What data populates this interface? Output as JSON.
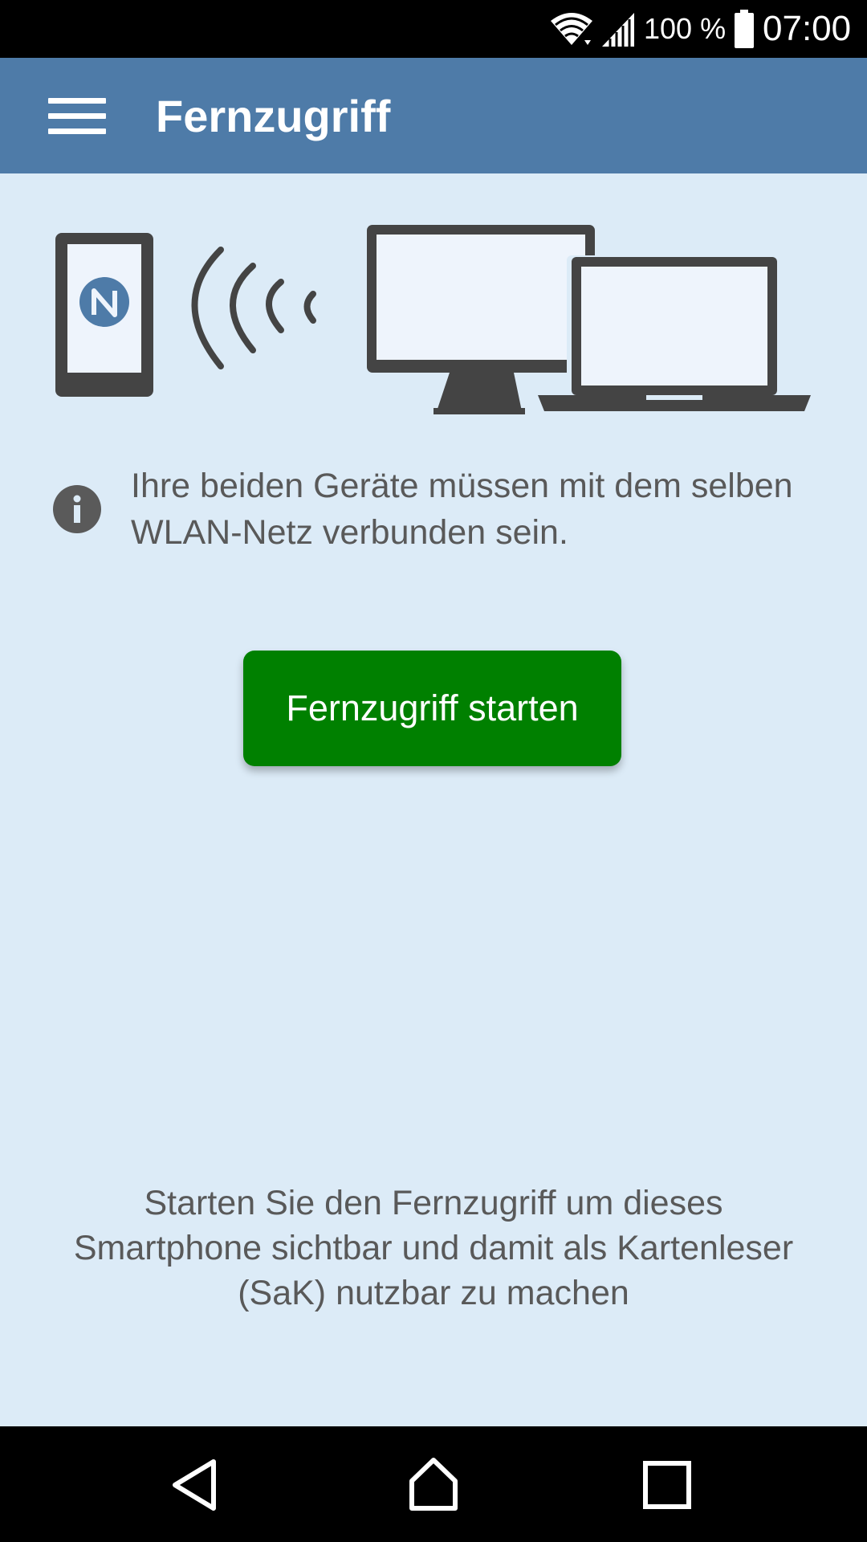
{
  "status_bar": {
    "battery_percent": "100 %",
    "time": "07:00",
    "icons": [
      "wifi-icon",
      "signal-icon",
      "battery-icon"
    ]
  },
  "app_bar": {
    "title": "Fernzugriff",
    "menu_icon": "menu-icon"
  },
  "illustration": {
    "icons": [
      "phone-nfc-icon",
      "nfc-waves-icon",
      "monitor-icon",
      "laptop-icon"
    ]
  },
  "info": {
    "icon": "info-icon",
    "text": "Ihre beiden Geräte müssen mit dem selben WLAN-Netz verbunden sein."
  },
  "main": {
    "start_button_label": "Fernzugriff starten",
    "description": "Starten Sie den Fernzugriff um dieses Smartphone sichtbar und damit als Kartenleser (SaK) nutzbar zu machen"
  },
  "nav_bar": {
    "icons": [
      "back-icon",
      "home-icon",
      "recents-icon"
    ]
  },
  "colors": {
    "app_bar": "#4e7ba8",
    "background": "#dcebf7",
    "button": "#008000",
    "text": "#595959",
    "icon_dark": "#444444"
  }
}
